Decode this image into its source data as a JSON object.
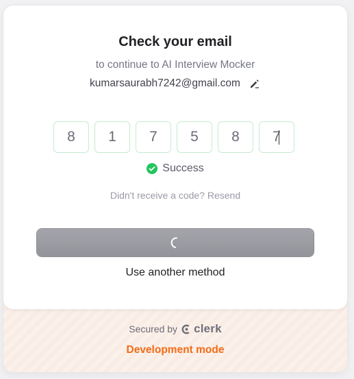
{
  "header": {
    "title": "Check your email",
    "subtitle": "to continue to AI Interview Mocker",
    "email": "kumarsaurabh7242@gmail.com"
  },
  "otp": {
    "digits": [
      "8",
      "1",
      "7",
      "5",
      "8",
      "7"
    ]
  },
  "status": {
    "text": "Success",
    "color": "#22c55e"
  },
  "resend": {
    "prompt": "Didn't receive a code?",
    "link": "Resend"
  },
  "actions": {
    "alt_method": "Use another method"
  },
  "footer": {
    "secured_by": "Secured by",
    "brand": "clerk",
    "mode": "Development mode",
    "mode_color": "#f36b16"
  },
  "icons": {
    "edit": "pencil-icon",
    "success": "check-circle-icon",
    "spinner": "spinner-icon",
    "brand": "clerk-logo-icon"
  }
}
